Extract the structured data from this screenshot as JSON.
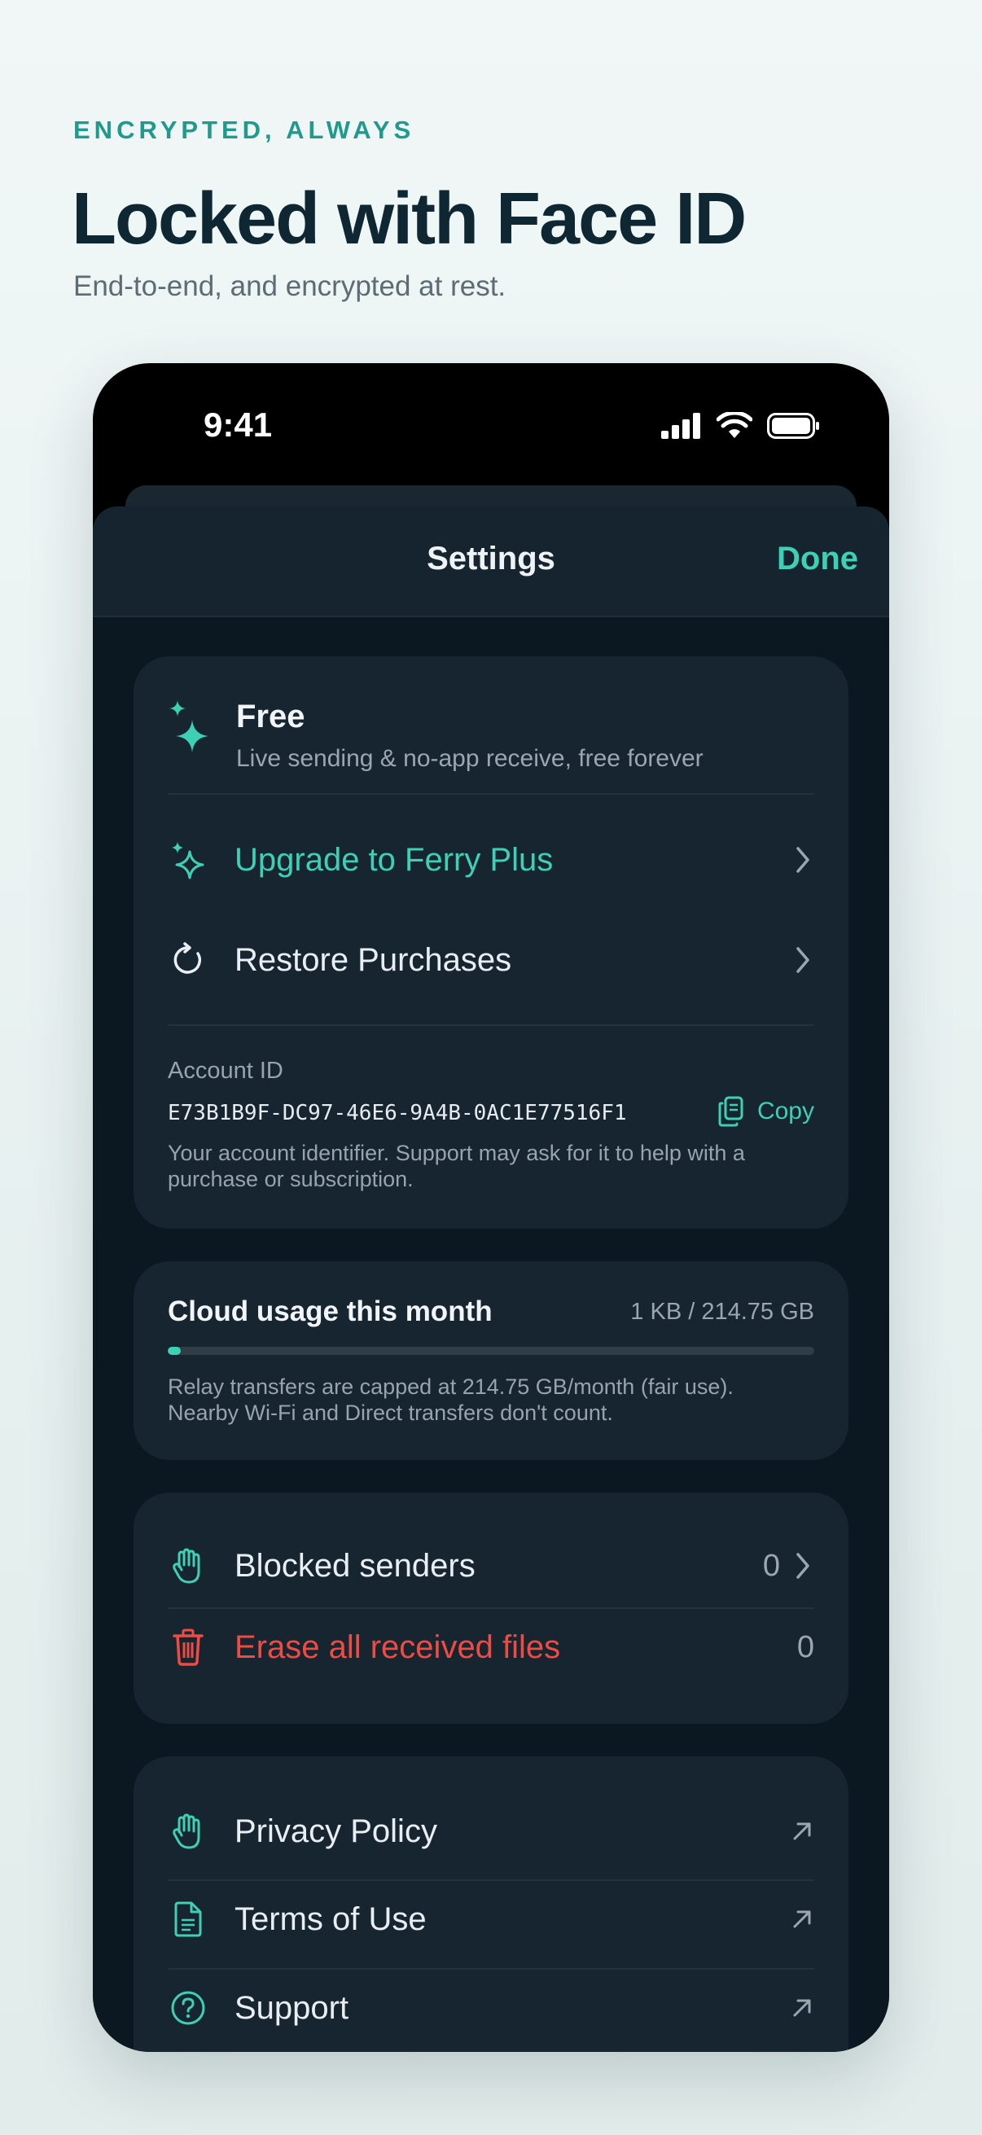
{
  "hero": {
    "eyebrow": "ENCRYPTED, ALWAYS",
    "headline": "Locked with Face ID",
    "subhead": "End-to-end, and encrypted at rest."
  },
  "status_bar": {
    "time": "9:41"
  },
  "nav": {
    "title": "Settings",
    "done_label": "Done"
  },
  "plan": {
    "title": "Free",
    "subtitle": "Live sending & no-app receive, free forever",
    "upgrade_label": "Upgrade to Ferry Plus",
    "restore_label": "Restore Purchases"
  },
  "account": {
    "label": "Account ID",
    "id": "E73B1B9F-DC97-46E6-9A4B-0AC1E77516F1",
    "copy_label": "Copy",
    "note": "Your account identifier. Support may ask for it to help with a purchase or subscription."
  },
  "usage": {
    "title": "Cloud usage this month",
    "amount": "1 KB / 214.75 GB",
    "progress_fraction": 0.02,
    "note": "Relay transfers are capped at 214.75 GB/month (fair use). Nearby Wi-Fi and Direct transfers don't count."
  },
  "privacy_rows": {
    "blocked_label": "Blocked senders",
    "blocked_count": "0",
    "erase_label": "Erase all received files",
    "erase_count": "0"
  },
  "links": {
    "privacy_label": "Privacy Policy",
    "terms_label": "Terms of Use",
    "support_label": "Support"
  },
  "colors": {
    "accent": "#3ed0b4",
    "destructive": "#ef4b43",
    "eyebrow": "#1f9a8c",
    "headline": "#0f2733"
  },
  "icons": {
    "plan": "sparkles-icon",
    "upgrade": "sparkles-icon",
    "restore": "refresh-icon",
    "copy": "copy-icon",
    "blocked": "hand-icon",
    "erase": "trash-icon",
    "privacy": "hand-icon",
    "terms": "document-icon",
    "support": "question-circle-icon"
  }
}
